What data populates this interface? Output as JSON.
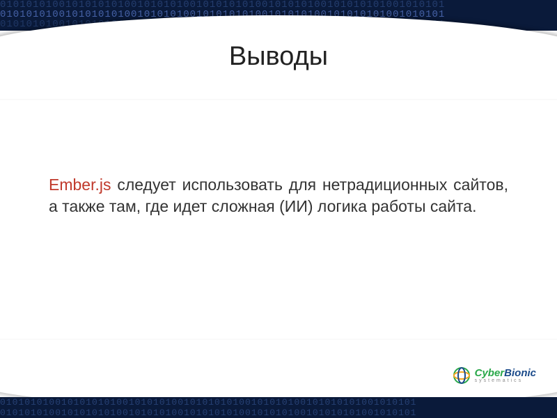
{
  "slide": {
    "title": "Выводы",
    "body_highlight": "Ember.js",
    "body_rest": " следует использовать для нетрадиционных сайтов, а также там, где идет сложная (ИИ) логика работы сайта."
  },
  "decoration": {
    "binary_row": "01010101001010101010010101010010101010100101010100101010101001010101"
  },
  "logo": {
    "brand_part1": "Cyber",
    "brand_part2": "Bionic",
    "tagline": "systematics"
  }
}
